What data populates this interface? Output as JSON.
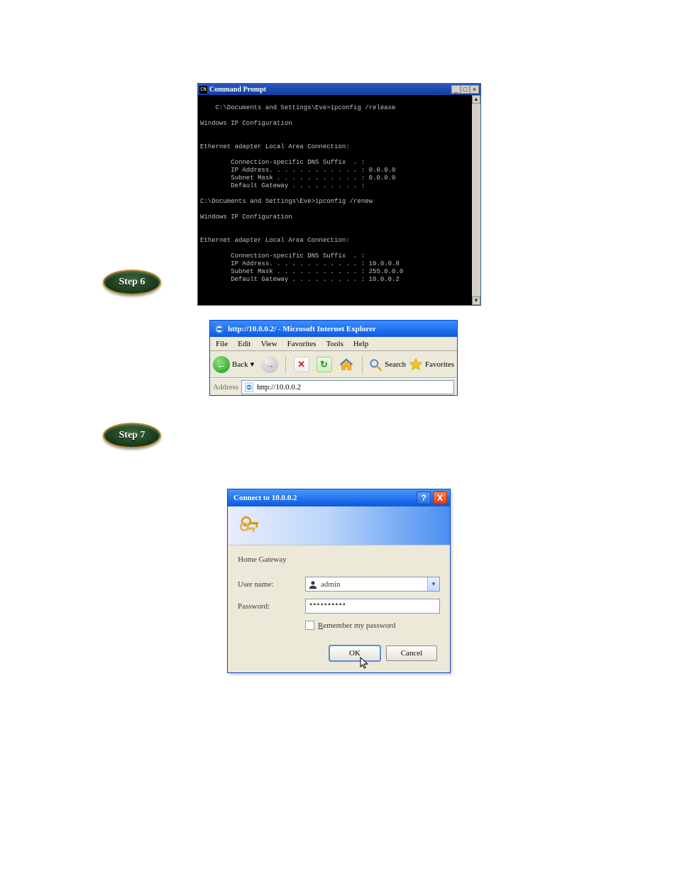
{
  "cmd": {
    "title": "Command Prompt",
    "icon_label": "CN",
    "lines": "C:\\Documents and Settings\\Eve>ipconfig /release\n\nWindows IP Configuration\n\n\nEthernet adapter Local Area Connection:\n\n        Connection-specific DNS Suffix  . :\n        IP Address. . . . . . . . . . . . : 0.0.0.0\n        Subnet Mask . . . . . . . . . . . : 0.0.0.0\n        Default Gateway . . . . . . . . . :\n\nC:\\Documents and Settings\\Eve>ipconfig /renew\n\nWindows IP Configuration\n\n\nEthernet adapter Local Area Connection:\n\n        Connection-specific DNS Suffix  . :\n        IP Address. . . . . . . . . . . . : 10.0.0.8\n        Subnet Mask . . . . . . . . . . . : 255.0.0.0\n        Default Gateway . . . . . . . . . : 10.0.0.2",
    "min_label": "_",
    "max_label": "□",
    "close_label": "×",
    "scroll_up": "▲",
    "scroll_down": "▼"
  },
  "steps": {
    "six": "Step 6",
    "seven": "Step 7"
  },
  "ie": {
    "title": "http://10.0.0.2/ - Microsoft Internet Explorer",
    "menu": {
      "file": "File",
      "edit": "Edit",
      "view": "View",
      "favorites": "Favorites",
      "tools": "Tools",
      "help": "Help"
    },
    "toolbar": {
      "back_glyph": "←",
      "back_label": "Back",
      "back_drop": "▾",
      "fwd_glyph": "→",
      "stop_glyph": "✕",
      "refresh_glyph": "↻",
      "search_label": "Search",
      "favorites_label": "Favorites"
    },
    "address_label": "Address",
    "address_value": "http://10.0.0.2"
  },
  "dlg": {
    "title": "Connect to 10.0.0.2",
    "help_glyph": "?",
    "close_glyph": "X",
    "subtitle": "Home Gateway",
    "user_label": "User name:",
    "user_value": "admin",
    "drop_glyph": "▾",
    "pass_label": "Password:",
    "pass_value": "••••••••••",
    "remember_prefix_u": "R",
    "remember_rest": "emember my password",
    "ok": "OK",
    "cancel": "Cancel"
  }
}
